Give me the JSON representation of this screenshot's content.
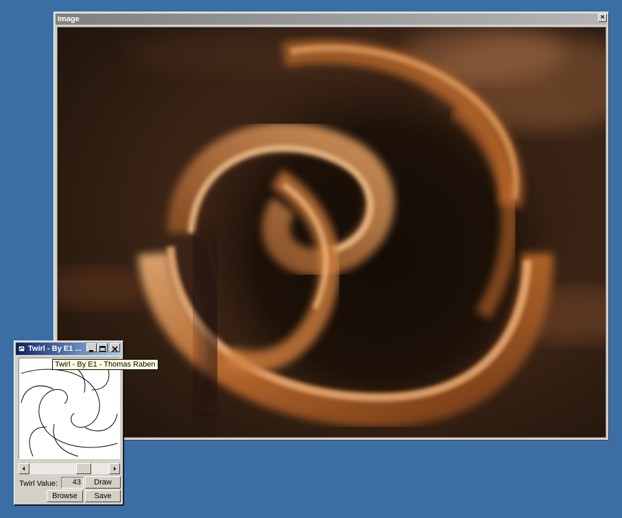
{
  "image_window": {
    "title": "Image",
    "close_glyph": "×",
    "close_icon": "close-icon"
  },
  "twirl_window": {
    "title": "Twirl - By E1 ...",
    "app_icon": "app-icon",
    "twirl_label": "Twirl Value:",
    "twirl_value": "43",
    "draw_label": "Draw",
    "browse_label": "Browse",
    "save_label": "Save",
    "scroll_position": 0.72
  },
  "tooltip": {
    "text": "Twirl - By E1 - Thomas Raben"
  },
  "colors": {
    "desktop": "#3a6ea5",
    "active_title_start": "#0a246a",
    "active_title_end": "#a6caf0",
    "inactive_title_start": "#808080",
    "inactive_title_end": "#b5b5b5"
  }
}
